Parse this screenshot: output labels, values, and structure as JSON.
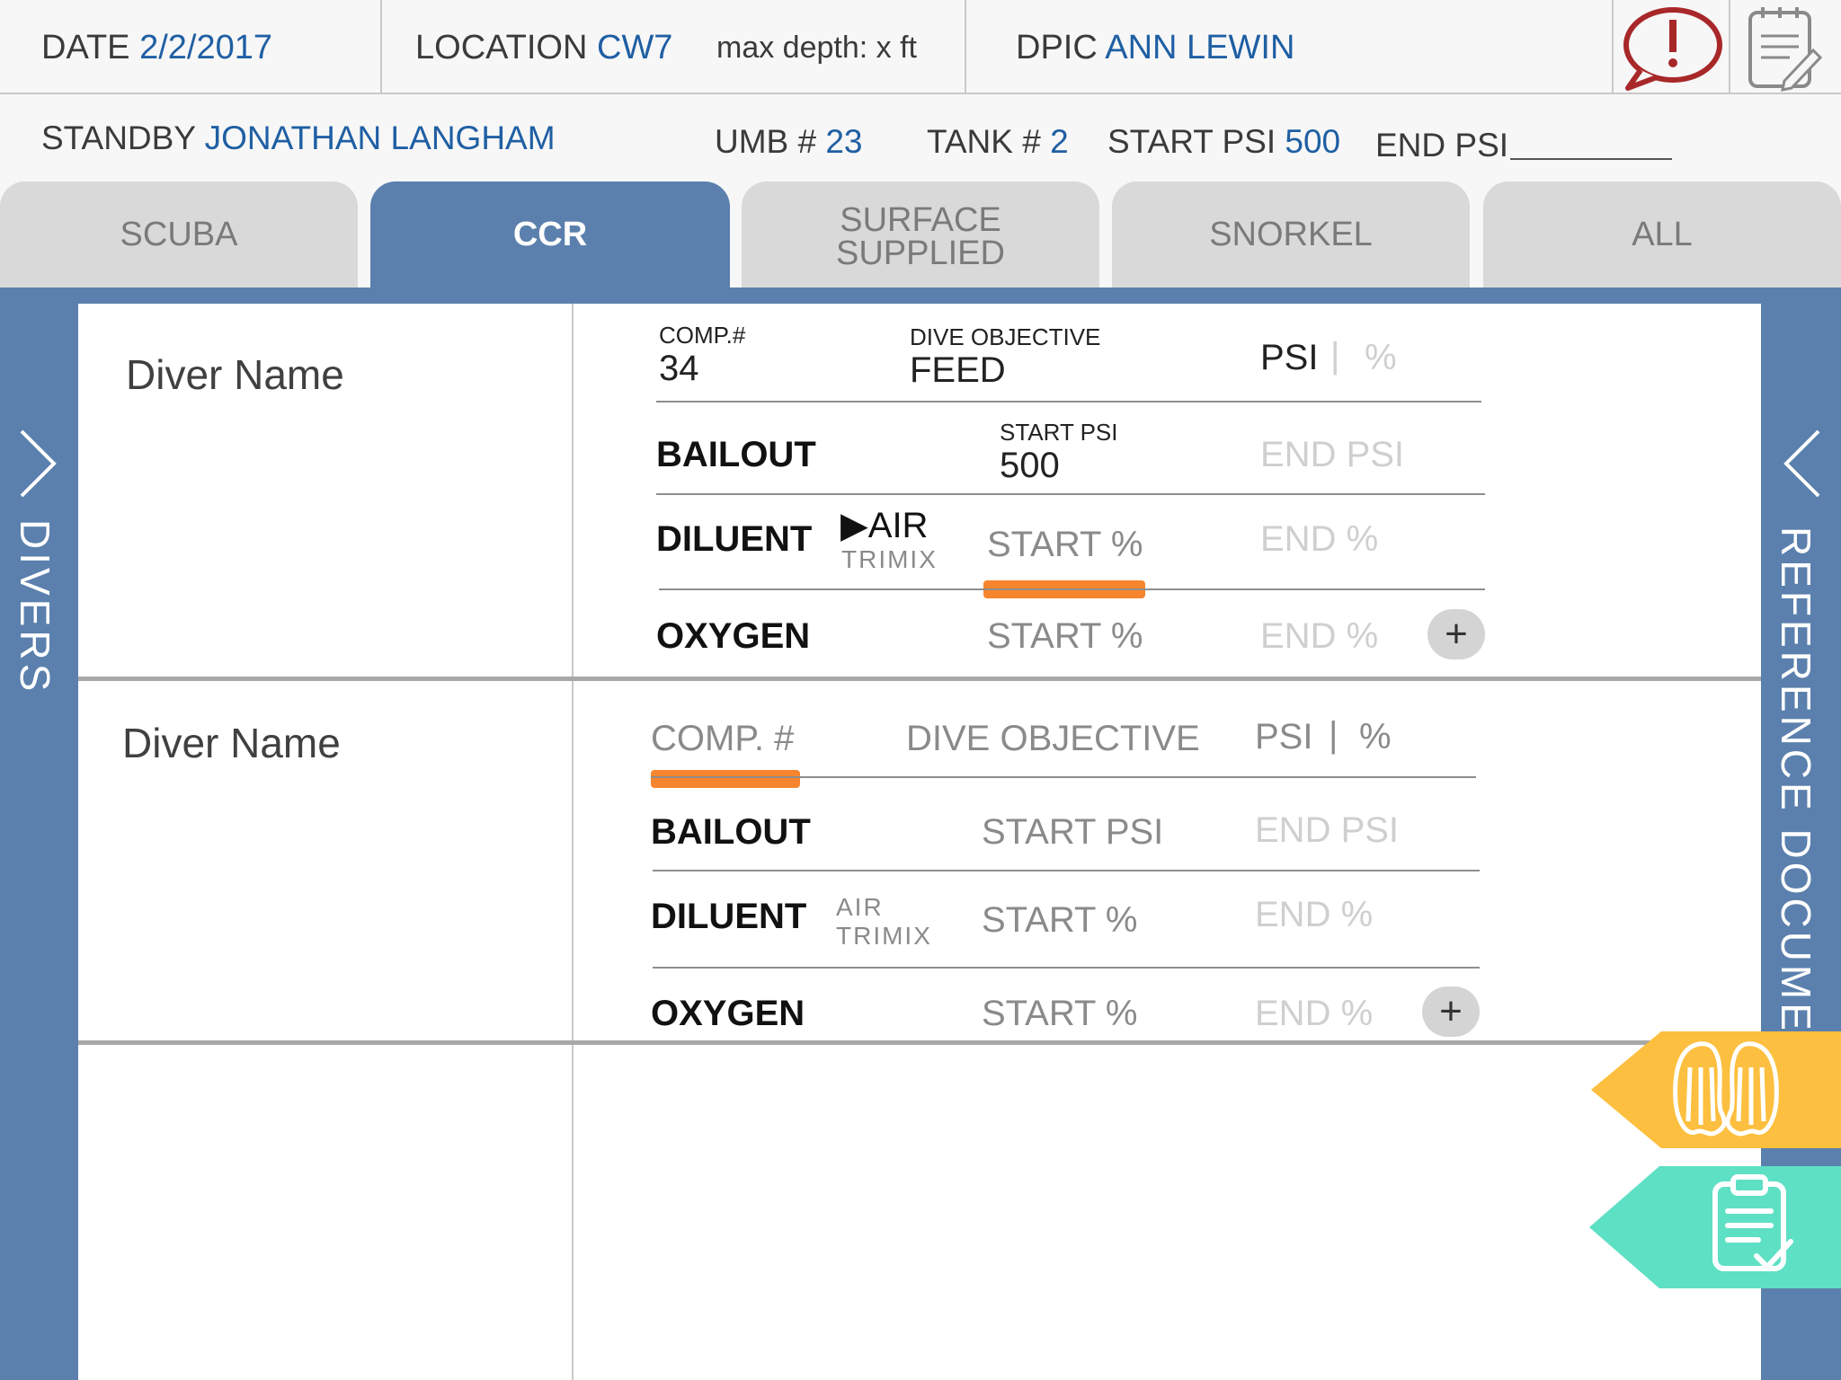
{
  "header": {
    "date_label": "DATE",
    "date_value": "2/2/2017",
    "location_label": "LOCATION",
    "location_value": "CW7",
    "max_depth": "max depth: x ft",
    "dpic_label": "DPIC",
    "dpic_value": "ANN LEWIN",
    "alert_icon": "alert-speech-bubble-icon",
    "notes_icon": "notepad-icon"
  },
  "subheader": {
    "standby_label": "STANDBY",
    "standby_value": "JONATHAN LANGHAM",
    "umb_label": "UMB #",
    "umb_value": "23",
    "tank_label": "TANK #",
    "tank_value": "2",
    "start_psi_label": "START PSI",
    "start_psi_value": "500",
    "end_psi_label": "END PSI",
    "end_psi_value": ""
  },
  "tabs": [
    {
      "line1": "SCUBA",
      "line2": "",
      "active": false
    },
    {
      "line1": "CCR",
      "line2": "",
      "active": true
    },
    {
      "line1": "SURFACE",
      "line2": "SUPPLIED",
      "active": false
    },
    {
      "line1": "SNORKEL",
      "line2": "",
      "active": false
    },
    {
      "line1": "ALL",
      "line2": "",
      "active": false
    }
  ],
  "side_panels": {
    "left_label": "DIVERS",
    "right_label": "REFERENCE DOCUMENTS"
  },
  "divers": [
    {
      "name": "Diver Name",
      "comp_label": "COMP.#",
      "comp_value": "34",
      "objective_label": "DIVE OBJECTIVE",
      "objective_value": "FEED",
      "unit_psi": "PSI",
      "unit_sep": "|",
      "unit_pct": "%",
      "bailout_label": "BAILOUT",
      "start_psi_label": "START PSI",
      "start_psi_value": "500",
      "end_psi_placeholder": "END PSI",
      "diluent_label": "DILUENT",
      "gas_air": "▶AIR",
      "gas_trimix": "TRIMIX",
      "start_pct_placeholder": "START %",
      "end_pct_placeholder": "END %",
      "oxygen_label": "OXYGEN",
      "oxygen_start_placeholder": "START %",
      "oxygen_end_placeholder": "END %",
      "add_symbol": "+"
    },
    {
      "name": "Diver Name",
      "comp_placeholder": "COMP. #",
      "objective_placeholder": "DIVE OBJECTIVE",
      "unit_psi": "PSI",
      "unit_sep": "|",
      "unit_pct": "%",
      "bailout_label": "BAILOUT",
      "start_psi_placeholder": "START PSI",
      "end_psi_placeholder": "END PSI",
      "diluent_label": "DILUENT",
      "gas_air": "AIR",
      "gas_trimix": "TRIMIX",
      "start_pct_placeholder": "START %",
      "end_pct_placeholder": "END %",
      "oxygen_label": "OXYGEN",
      "oxygen_start_placeholder": "START %",
      "oxygen_end_placeholder": "END %",
      "add_symbol": "+"
    }
  ],
  "colors": {
    "accent_blue": "#5b80ad",
    "value_blue": "#1f5fa3",
    "orange_indicator": "#f7852d",
    "fins_tag": "#fdbf3f",
    "checklist_tag": "#5ee0c4",
    "alert_red": "#a8282a"
  },
  "tags": {
    "fins_icon": "swim-fins-icon",
    "checklist_icon": "clipboard-check-icon"
  }
}
